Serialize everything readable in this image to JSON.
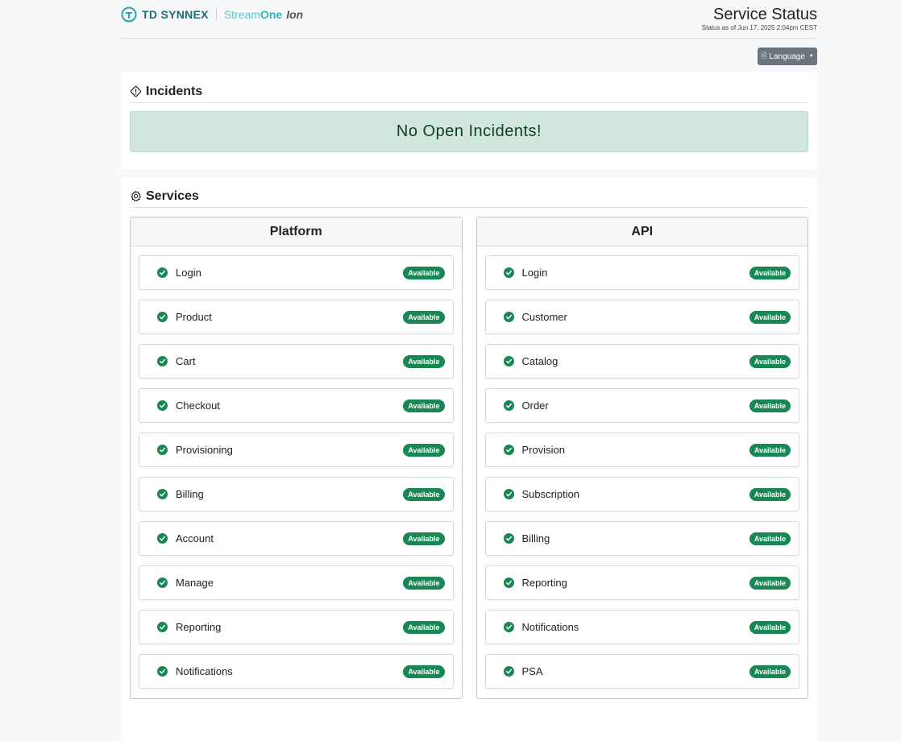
{
  "brand": {
    "td": "TD SYNNEX",
    "stream": "Stream",
    "one": "One",
    "ion": "Ion"
  },
  "header": {
    "title": "Service Status",
    "subtitle": "Status as of Jun 17, 2025 2:04pm CEST"
  },
  "language": {
    "label": "Language"
  },
  "incidents": {
    "title": "Incidents",
    "message": "No Open Incidents!"
  },
  "services": {
    "title": "Services",
    "platform": {
      "title": "Platform",
      "items": [
        {
          "name": "Login",
          "status": "Available"
        },
        {
          "name": "Product",
          "status": "Available"
        },
        {
          "name": "Cart",
          "status": "Available"
        },
        {
          "name": "Checkout",
          "status": "Available"
        },
        {
          "name": "Provisioning",
          "status": "Available"
        },
        {
          "name": "Billing",
          "status": "Available"
        },
        {
          "name": "Account",
          "status": "Available"
        },
        {
          "name": "Manage",
          "status": "Available"
        },
        {
          "name": "Reporting",
          "status": "Available"
        },
        {
          "name": "Notifications",
          "status": "Available"
        }
      ]
    },
    "api": {
      "title": "API",
      "items": [
        {
          "name": "Login",
          "status": "Available"
        },
        {
          "name": "Customer",
          "status": "Available"
        },
        {
          "name": "Catalog",
          "status": "Available"
        },
        {
          "name": "Order",
          "status": "Available"
        },
        {
          "name": "Provision",
          "status": "Available"
        },
        {
          "name": "Subscription",
          "status": "Available"
        },
        {
          "name": "Billing",
          "status": "Available"
        },
        {
          "name": "Reporting",
          "status": "Available"
        },
        {
          "name": "Notifications",
          "status": "Available"
        },
        {
          "name": "PSA",
          "status": "Available"
        }
      ]
    }
  },
  "colors": {
    "brand_teal": "#1d6d72",
    "status_green": "#198754",
    "alert_bg": "#d1e7dd"
  }
}
